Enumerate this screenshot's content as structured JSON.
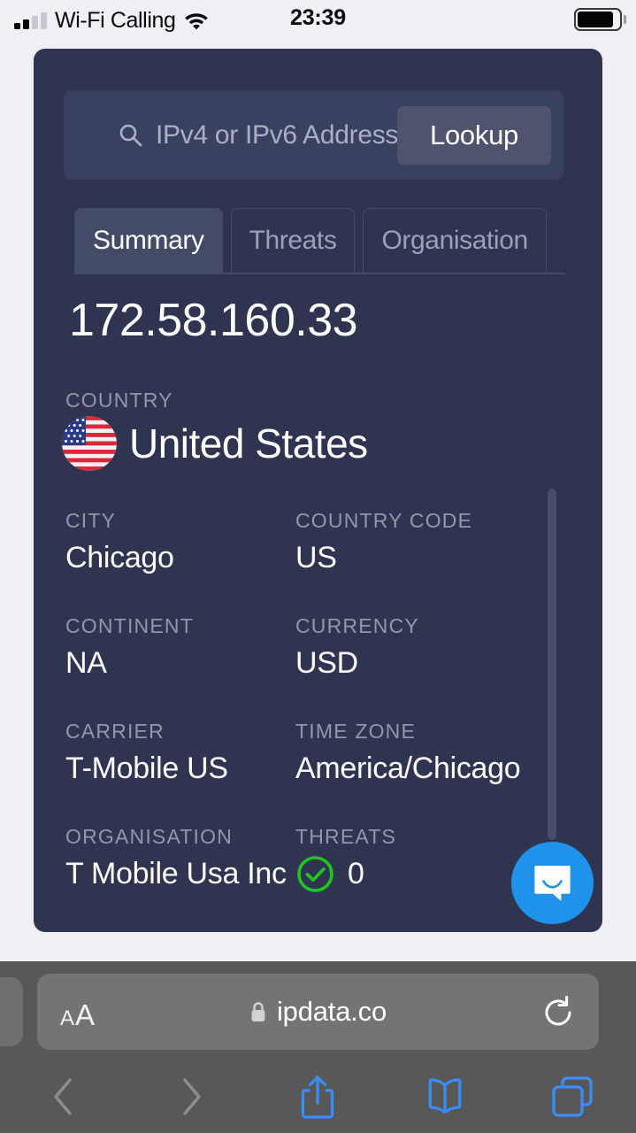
{
  "status_bar": {
    "carrier_text": "Wi-Fi Calling",
    "time": "23:39",
    "signal_icon": "cellular-signal-icon",
    "wifi_icon": "wifi-icon",
    "battery_icon": "battery-icon"
  },
  "app": {
    "search": {
      "placeholder": "IPv4 or IPv6 Address",
      "value": "",
      "search_icon": "search-icon",
      "lookup_label": "Lookup"
    },
    "tabs": [
      {
        "label": "Summary",
        "active": true
      },
      {
        "label": "Threats",
        "active": false
      },
      {
        "label": "Organisation",
        "active": false
      }
    ],
    "ip_address": "172.58.160.33",
    "country": {
      "label": "COUNTRY",
      "name": "United States",
      "flag_icon": "us-flag-icon"
    },
    "fields": [
      {
        "label": "CITY",
        "value": "Chicago"
      },
      {
        "label": "COUNTRY CODE",
        "value": "US"
      },
      {
        "label": "CONTINENT",
        "value": "NA"
      },
      {
        "label": "CURRENCY",
        "value": "USD"
      },
      {
        "label": "CARRIER",
        "value": "T-Mobile US"
      },
      {
        "label": "TIME ZONE",
        "value": "America/Chicago"
      },
      {
        "label": "ORGANISATION",
        "value": "T Mobile Usa Inc"
      },
      {
        "label": "THREATS",
        "value": "0",
        "icon": "check-circle-icon"
      }
    ],
    "colors": {
      "card_background": "#2f3550",
      "search_background": "#3a4160",
      "active_tab": "#444b67",
      "label_text": "#9097ae",
      "value_text": "#ffffff",
      "threat_ok": "#22c51e",
      "intercom_blue": "#1f93ec",
      "page_background": "#eff0f5"
    },
    "intercom": {
      "icon": "chat-bubble-icon"
    }
  },
  "browser": {
    "text_size_label_small": "A",
    "text_size_label_large": "A",
    "lock_icon": "lock-icon",
    "url": "ipdata.co",
    "reload_icon": "reload-icon",
    "toolbar": [
      {
        "name": "back",
        "icon": "chevron-left-icon",
        "enabled": false
      },
      {
        "name": "forward",
        "icon": "chevron-right-icon",
        "enabled": false
      },
      {
        "name": "share",
        "icon": "share-icon",
        "enabled": true
      },
      {
        "name": "bookmarks",
        "icon": "book-icon",
        "enabled": true
      },
      {
        "name": "tabs",
        "icon": "tabs-icon",
        "enabled": true
      }
    ],
    "accent": "#3a8dff"
  }
}
